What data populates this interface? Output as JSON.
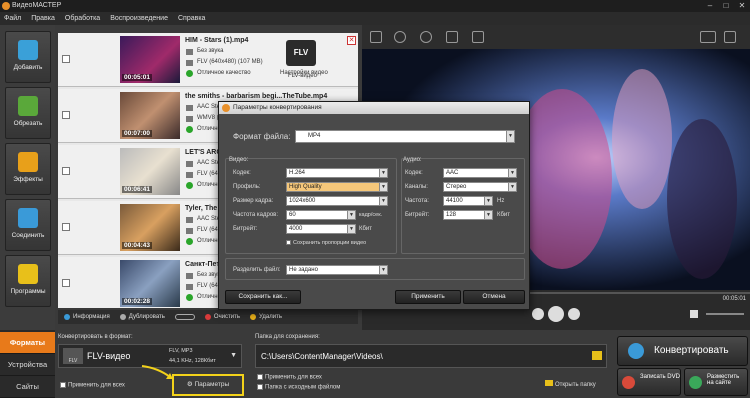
{
  "window": {
    "title": "ВидеоМАСТЕР"
  },
  "menu": [
    "Файл",
    "Правка",
    "Обработка",
    "Воспроизведение",
    "Справка"
  ],
  "sidebar": [
    {
      "label": "Добавить",
      "icon": "add-icon"
    },
    {
      "label": "Обрезать",
      "icon": "cut-icon"
    },
    {
      "label": "Эффекты",
      "icon": "effects-icon"
    },
    {
      "label": "Соединить",
      "icon": "join-icon"
    },
    {
      "label": "Программы",
      "icon": "programs-icon"
    }
  ],
  "files": [
    {
      "name": "HIM - Stars (1).mp4",
      "duration": "00:05:01",
      "audio": "Без звука",
      "video": "FLV (640x480) (107 MB)",
      "quality": "Отличное качество",
      "extra": "Настройки видео",
      "format": "FLV",
      "format_label": "FLV-видео"
    },
    {
      "name": "the smiths - barbarism begi...TheTube.mp4",
      "duration": "00:07:00",
      "audio": "AAC Stereo (und)",
      "video": "WMV8 (540x360) (135 MB)",
      "quality": "Отличное качество",
      "extra": "",
      "format": "",
      "format_label": ""
    },
    {
      "name": "LET'S ARGUE_ Lady Gaga F",
      "duration": "00:06:41",
      "audio": "AAC Stereo (und)",
      "video": "FLV (640x480) (142 MB)",
      "quality": "Отличное качество",
      "extra": "",
      "format": "",
      "format_label": ""
    },
    {
      "name": "Tyler, The Creator - EARFC",
      "duration": "00:04:43",
      "audio": "AAC Stereo (und)",
      "video": "FLV (640x480) (114 MB)",
      "quality": "Отличное качество",
      "extra": "",
      "format": "",
      "format_label": ""
    },
    {
      "name": "Санкт-Петербург в 4К_0",
      "duration": "00:02:28",
      "audio": "Без звука",
      "video": "FLV (640x480) (85 MB)",
      "quality": "Отличное качество",
      "extra": "",
      "format": "",
      "format_label": ""
    }
  ],
  "list_toolbar": {
    "info": "Информация",
    "duplicate": "Дублировать",
    "clear": "Очистить",
    "delete": "Удалить"
  },
  "preview": {
    "time": "00:05:01"
  },
  "dialog": {
    "title": "Параметры конвертирования",
    "format_label": "Формат файла:",
    "format_value": "MP4",
    "video_group": "Видео:",
    "audio_group": "Аудио:",
    "video": {
      "codec_label": "Кодек:",
      "codec": "H.264",
      "profile_label": "Профиль:",
      "profile": "High Quality",
      "size_label": "Размер кадра:",
      "size": "1024x600",
      "fps_label": "Частота кадров:",
      "fps": "60",
      "fps_unit": "кадр/сек.",
      "bitrate_label": "Битрейт:",
      "bitrate": "4000",
      "bitrate_unit": "Кбит",
      "keep_ratio": "Сохранить пропорции видео"
    },
    "audio": {
      "codec_label": "Кодек:",
      "codec": "AAC",
      "channels_label": "Каналы:",
      "channels": "Стерео",
      "freq_label": "Частота:",
      "freq": "44100",
      "freq_unit": "Hz",
      "bitrate_label": "Битрейт:",
      "bitrate": "128",
      "bitrate_unit": "Кбит"
    },
    "split_label": "Разделить файл:",
    "split_value": "Не задано",
    "save_as": "Сохранить как...",
    "apply": "Применить",
    "cancel": "Отмена"
  },
  "bottom": {
    "tabs": [
      "Форматы",
      "Устройства",
      "Сайты"
    ],
    "convert_to_label": "Конвертировать в формат:",
    "format_name": "FLV-видео",
    "format_badge": "FLV",
    "format_info1": "FLV, MP3",
    "format_info2": "44,1 KHz, 128Кбит",
    "apply_all": "Применить для всех",
    "params": "Параметры",
    "save_folder_label": "Папка для сохранения:",
    "save_path": "C:\\Users\\ContentManager\\Videos\\",
    "apply_all2": "Применить для всех",
    "source_folder": "Папка с исходным файлом",
    "open_folder": "Открыть папку",
    "convert": "Конвертировать",
    "burn_dvd": "Записать DVD",
    "publish": "Разместить на сайте"
  }
}
